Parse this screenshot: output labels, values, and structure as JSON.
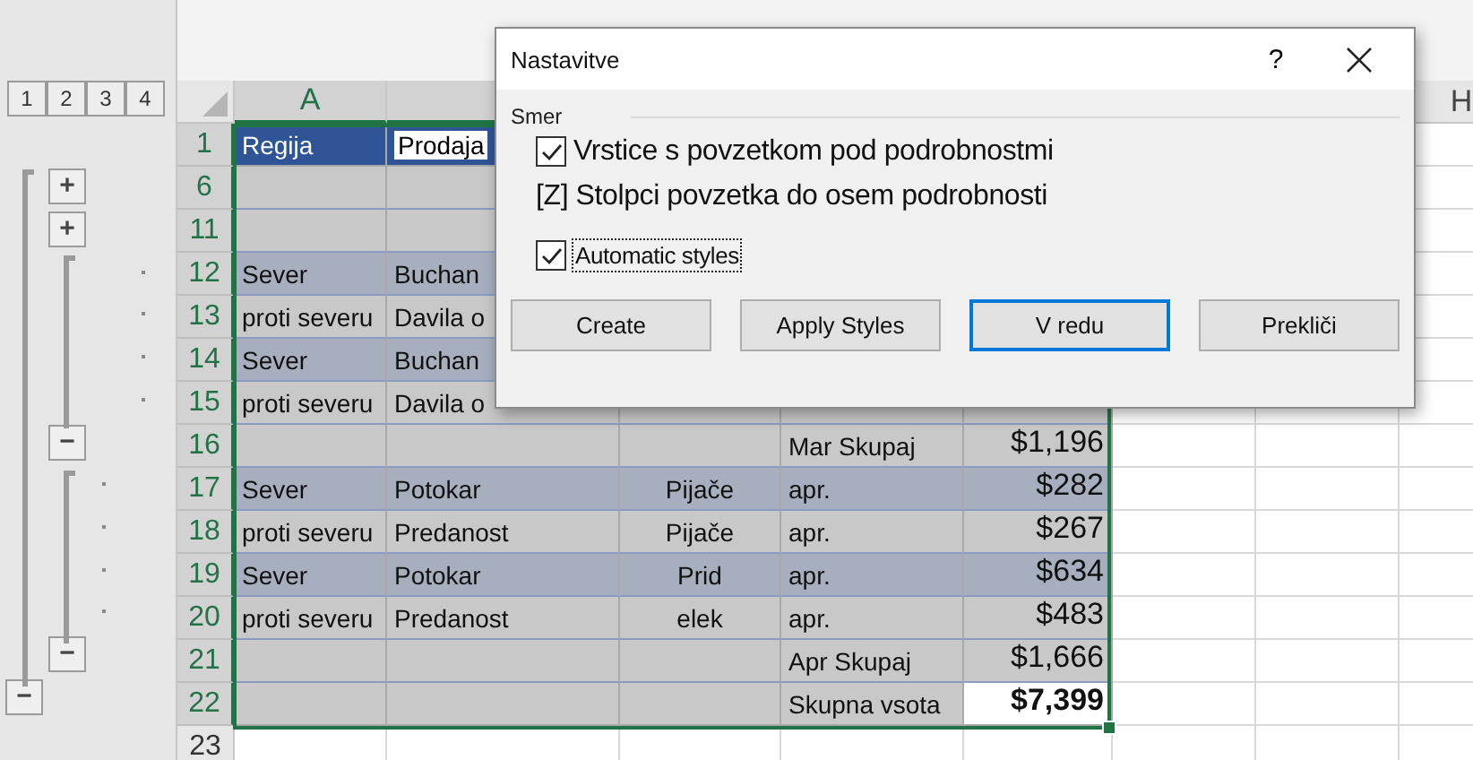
{
  "outline_levels": [
    "1",
    "2",
    "3",
    "4"
  ],
  "columns": [
    {
      "header": "A",
      "selected": true
    },
    {
      "selected": true
    },
    {},
    {},
    {},
    {},
    {},
    {
      "header": "H",
      "selected": false
    }
  ],
  "rows": [
    {
      "header": "1",
      "selected": true,
      "kind": "header",
      "cells": {
        "A": "Regija",
        "B": "Prodaja"
      }
    },
    {
      "header": "6",
      "selected": true,
      "kind": "plain",
      "outline": {
        "kind": "inner",
        "symbol": "+"
      },
      "cells": {}
    },
    {
      "header": "11",
      "selected": true,
      "kind": "plain",
      "outline": {
        "kind": "inner",
        "symbol": "+"
      },
      "cells": {}
    },
    {
      "header": "12",
      "selected": true,
      "kind": "band",
      "outline": {
        "kind": "deepdot"
      },
      "cells": {
        "A": "Sever",
        "B": "Buchan"
      }
    },
    {
      "header": "13",
      "selected": true,
      "kind": "plain",
      "outline": {
        "kind": "deepdot"
      },
      "cells": {
        "A": "proti severu",
        "B": "Davila o"
      }
    },
    {
      "header": "14",
      "selected": true,
      "kind": "band",
      "outline": {
        "kind": "deepdot"
      },
      "cells": {
        "A": "Sever",
        "B": "Buchan"
      }
    },
    {
      "header": "15",
      "selected": true,
      "kind": "plain",
      "outline": {
        "kind": "deepdot"
      },
      "cells": {
        "A": "proti severu",
        "B": "Davila o"
      }
    },
    {
      "header": "16",
      "selected": true,
      "kind": "plain",
      "outline": {
        "kind": "inner",
        "symbol": "−"
      },
      "cells": {
        "D": "Mar Skupaj",
        "E": "$1,196"
      }
    },
    {
      "header": "17",
      "selected": true,
      "kind": "band",
      "outline": {
        "kind": "dot"
      },
      "cells": {
        "A": "Sever",
        "B": "Potokar",
        "C": "Pijače",
        "D": "apr.",
        "E": "$282"
      }
    },
    {
      "header": "18",
      "selected": true,
      "kind": "plain",
      "outline": {
        "kind": "dot"
      },
      "cells": {
        "A": "proti severu",
        "B": "Predanost",
        "C": "Pijače",
        "D": "apr.",
        "E": "$267"
      }
    },
    {
      "header": "19",
      "selected": true,
      "kind": "band",
      "outline": {
        "kind": "dot"
      },
      "cells": {
        "A": "Sever",
        "B": "Potokar",
        "C": "Prid",
        "D": "apr.",
        "E": "$634"
      }
    },
    {
      "header": "20",
      "selected": true,
      "kind": "plain",
      "outline": {
        "kind": "dot"
      },
      "cells": {
        "A": "proti severu",
        "B": "Predanost",
        "C": "elek",
        "D": "apr.",
        "E": "$483"
      }
    },
    {
      "header": "21",
      "selected": true,
      "kind": "plain",
      "outline": {
        "kind": "inner",
        "symbol": "−"
      },
      "cells": {
        "D": "Apr Skupaj",
        "E": "$1,666"
      }
    },
    {
      "header": "22",
      "selected": true,
      "kind": "grand",
      "outline": {
        "kind": "outer",
        "symbol": "−"
      },
      "cells": {
        "D": "Skupna vsota",
        "E": "$7,399"
      }
    },
    {
      "header": "23",
      "selected": false,
      "kind": "empty",
      "cells": {}
    }
  ],
  "dialog": {
    "title": "Nastavitve",
    "help": "?",
    "group_label": "Smer",
    "options": [
      {
        "kind": "checkbox",
        "label": "Vrstice s povzetkom pod podrobnostmi",
        "checked": true,
        "focused": false
      },
      {
        "kind": "text",
        "label": "[Z] Stolpci povzetka do osem podrobnosti"
      },
      {
        "kind": "checkbox",
        "label": "Automatic styles",
        "checked": true,
        "focused": true
      }
    ],
    "buttons": [
      {
        "label": "Create",
        "default": false
      },
      {
        "label": "Apply Styles",
        "default": false
      },
      {
        "label": "V redu",
        "default": true
      },
      {
        "label": "Prekliči",
        "default": false
      }
    ]
  }
}
